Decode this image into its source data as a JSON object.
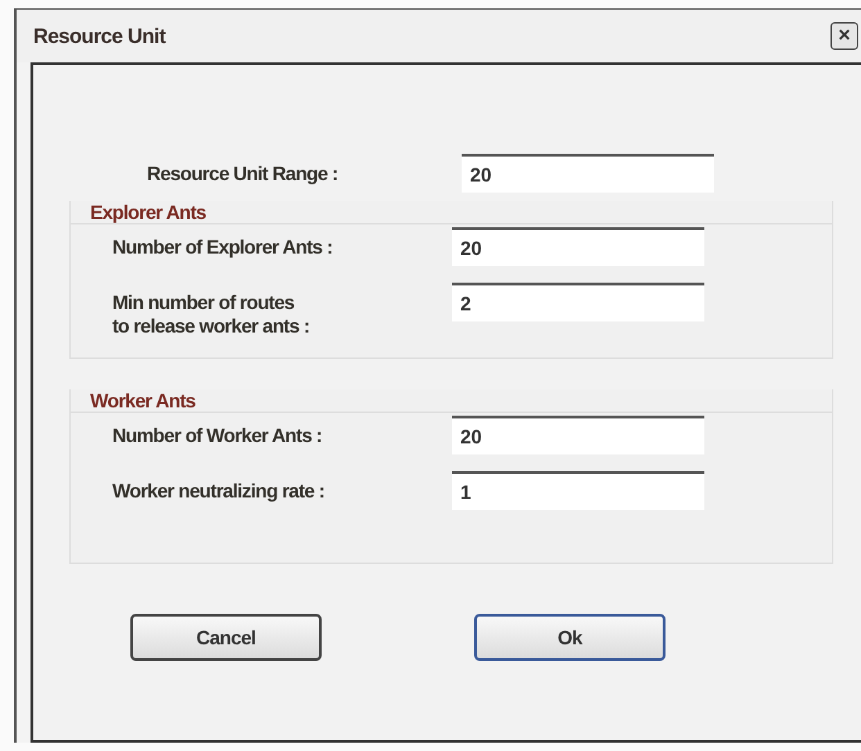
{
  "window": {
    "title": "Resource Unit",
    "close": "×"
  },
  "top_field": {
    "label": "Resource Unit Range :",
    "value": "20"
  },
  "groups": [
    {
      "title": "Explorer Ants",
      "fields": [
        {
          "label": "Number of Explorer Ants :",
          "value": "20"
        },
        {
          "label": "Min number of routes\nto release worker ants :",
          "value": "2"
        }
      ]
    },
    {
      "title": "Worker Ants",
      "fields": [
        {
          "label": "Number of Worker Ants :",
          "value": "20"
        },
        {
          "label": "Worker neutralizing rate :",
          "value": "1"
        }
      ]
    }
  ],
  "buttons": [
    {
      "label": "Cancel",
      "focused": false
    },
    {
      "label": "Ok",
      "focused": true
    }
  ]
}
